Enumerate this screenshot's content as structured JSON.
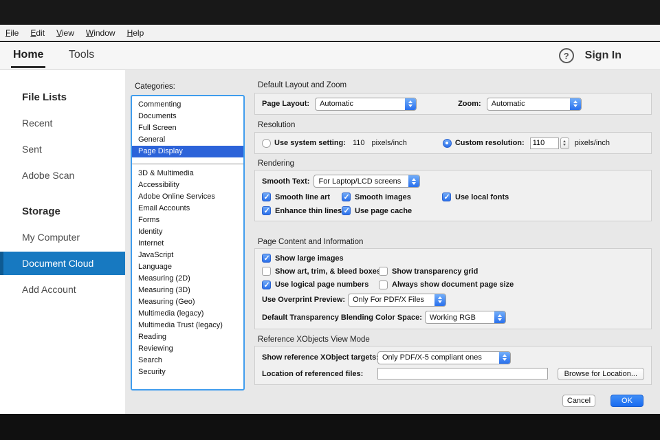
{
  "colors": {
    "accent_blue": "#2a72ec",
    "list_selection_blue": "#2c63d9",
    "sidebar_selection_blue": "#1779c1",
    "ok_button_blue": "#1f6ff2"
  },
  "menubar": {
    "items": [
      "File",
      "Edit",
      "View",
      "Window",
      "Help"
    ]
  },
  "nav": {
    "home": "Home",
    "tools": "Tools",
    "help_glyph": "?",
    "sign_in": "Sign In"
  },
  "sidebar": {
    "file_lists_header": "File Lists",
    "recent": "Recent",
    "sent": "Sent",
    "adobe_scan": "Adobe Scan",
    "storage_header": "Storage",
    "my_computer": "My Computer",
    "document_cloud": "Document Cloud",
    "add_account": "Add Account"
  },
  "prefs": {
    "categories_label": "Categories:",
    "cat_top": [
      "Commenting",
      "Documents",
      "Full Screen",
      "General",
      "Page Display"
    ],
    "cat_bottom": [
      "3D & Multimedia",
      "Accessibility",
      "Adobe Online Services",
      "Email Accounts",
      "Forms",
      "Identity",
      "Internet",
      "JavaScript",
      "Language",
      "Measuring (2D)",
      "Measuring (3D)",
      "Measuring (Geo)",
      "Multimedia (legacy)",
      "Multimedia Trust (legacy)",
      "Reading",
      "Reviewing",
      "Search",
      "Security"
    ],
    "selected_category": "Page Display",
    "layout": {
      "title": "Default Layout and Zoom",
      "page_layout_label": "Page Layout:",
      "page_layout_value": "Automatic",
      "zoom_label": "Zoom:",
      "zoom_value": "Automatic"
    },
    "resolution": {
      "title": "Resolution",
      "system_label": "Use system setting:",
      "system_value": "110",
      "system_unit": "pixels/inch",
      "custom_label": "Custom resolution:",
      "custom_value": "110",
      "custom_unit": "pixels/inch"
    },
    "rendering": {
      "title": "Rendering",
      "smooth_text_label": "Smooth Text:",
      "smooth_text_value": "For Laptop/LCD screens",
      "smooth_line_art": "Smooth line art",
      "smooth_images": "Smooth images",
      "use_local_fonts": "Use local fonts",
      "enhance_thin_lines": "Enhance thin lines",
      "use_page_cache": "Use page cache"
    },
    "content": {
      "title": "Page Content and Information",
      "show_large_images": "Show large images",
      "show_art_trim_bleed": "Show art, trim, & bleed boxes",
      "show_transparency_grid": "Show transparency grid",
      "use_logical_page_numbers": "Use logical page numbers",
      "always_show_page_size": "Always show document page size",
      "overprint_label": "Use Overprint Preview:",
      "overprint_value": "Only For PDF/X Files",
      "blend_label": "Default Transparency Blending Color Space:",
      "blend_value": "Working RGB"
    },
    "xobjects": {
      "title": "Reference XObjects View Mode",
      "targets_label": "Show reference XObject targets:",
      "targets_value": "Only PDF/X-5 compliant ones",
      "location_label": "Location of referenced files:",
      "location_value": "",
      "browse_button": "Browse for Location..."
    },
    "footer": {
      "cancel": "Cancel",
      "ok": "OK"
    }
  }
}
